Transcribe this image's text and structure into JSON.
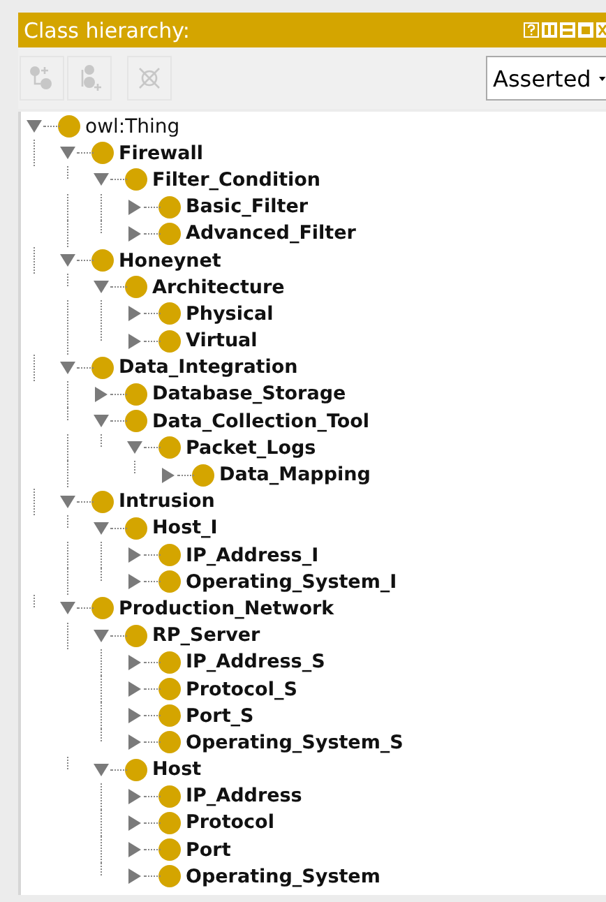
{
  "panel": {
    "title": "Class hierarchy:"
  },
  "toolbar": {
    "buttons": [
      {
        "kind": "add-sub",
        "disabled": true
      },
      {
        "kind": "add-sibling",
        "disabled": true
      },
      {
        "kind": "delete",
        "disabled": true
      }
    ],
    "view_select": {
      "value": "Asserted"
    }
  },
  "tree": [
    {
      "label": "owl:Thing",
      "bold": false,
      "expanded": true,
      "children": [
        {
          "label": "Firewall",
          "bold": true,
          "expanded": true,
          "children": [
            {
              "label": "Filter_Condition",
              "bold": true,
              "expanded": true,
              "children": [
                {
                  "label": "Basic_Filter",
                  "bold": true,
                  "expanded": false
                },
                {
                  "label": "Advanced_Filter",
                  "bold": true,
                  "expanded": false
                }
              ]
            }
          ]
        },
        {
          "label": "Honeynet",
          "bold": true,
          "expanded": true,
          "children": [
            {
              "label": "Architecture",
              "bold": true,
              "expanded": true,
              "children": [
                {
                  "label": "Physical",
                  "bold": true,
                  "expanded": false
                },
                {
                  "label": "Virtual",
                  "bold": true,
                  "expanded": false
                }
              ]
            }
          ]
        },
        {
          "label": "Data_Integration",
          "bold": true,
          "expanded": true,
          "children": [
            {
              "label": "Database_Storage",
              "bold": true,
              "expanded": false
            },
            {
              "label": "Data_Collection_Tool",
              "bold": true,
              "expanded": true,
              "children": [
                {
                  "label": "Packet_Logs",
                  "bold": true,
                  "expanded": true,
                  "children": [
                    {
                      "label": "Data_Mapping",
                      "bold": true,
                      "expanded": false
                    }
                  ]
                }
              ]
            }
          ]
        },
        {
          "label": "Intrusion",
          "bold": true,
          "expanded": true,
          "children": [
            {
              "label": "Host_I",
              "bold": true,
              "expanded": true,
              "children": [
                {
                  "label": "IP_Address_I",
                  "bold": true,
                  "expanded": false
                },
                {
                  "label": "Operating_System_I",
                  "bold": true,
                  "expanded": false
                }
              ]
            }
          ]
        },
        {
          "label": "Production_Network",
          "bold": true,
          "expanded": true,
          "children": [
            {
              "label": "RP_Server",
              "bold": true,
              "expanded": true,
              "children": [
                {
                  "label": "IP_Address_S",
                  "bold": true,
                  "expanded": false
                },
                {
                  "label": "Protocol_S",
                  "bold": true,
                  "expanded": false
                },
                {
                  "label": "Port_S",
                  "bold": true,
                  "expanded": false
                },
                {
                  "label": "Operating_System_S",
                  "bold": true,
                  "expanded": false
                }
              ]
            },
            {
              "label": "Host",
              "bold": true,
              "expanded": true,
              "children": [
                {
                  "label": "IP_Address",
                  "bold": true,
                  "expanded": false
                },
                {
                  "label": "Protocol",
                  "bold": true,
                  "expanded": false
                },
                {
                  "label": "Port",
                  "bold": true,
                  "expanded": false
                },
                {
                  "label": "Operating_System",
                  "bold": true,
                  "expanded": false
                }
              ]
            }
          ]
        }
      ]
    }
  ]
}
